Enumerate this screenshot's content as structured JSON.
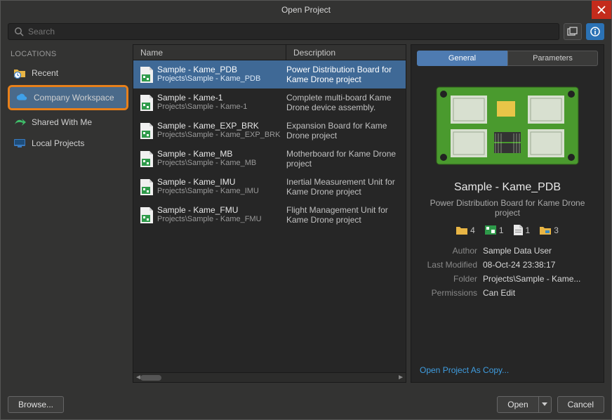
{
  "window": {
    "title": "Open Project"
  },
  "search": {
    "placeholder": "Search",
    "value": ""
  },
  "locations": {
    "label": "LOCATIONS",
    "items": [
      {
        "icon": "clock-folder",
        "label": "Recent"
      },
      {
        "icon": "cloud",
        "label": "Company Workspace"
      },
      {
        "icon": "share-arrow",
        "label": "Shared With Me"
      },
      {
        "icon": "monitor",
        "label": "Local Projects"
      }
    ],
    "selected_index": 1
  },
  "list": {
    "columns": {
      "name": "Name",
      "description": "Description"
    },
    "rows": [
      {
        "name": "Sample - Kame_PDB",
        "path": "Projects\\Sample - Kame_PDB",
        "desc": "Power Distribution Board for Kame Drone project"
      },
      {
        "name": "Sample - Kame-1",
        "path": "Projects\\Sample - Kame-1",
        "desc": "Complete multi-board Kame Drone device assembly."
      },
      {
        "name": "Sample - Kame_EXP_BRK",
        "path": "Projects\\Sample - Kame_EXP_BRK",
        "desc": "Expansion Board for Kame Drone project"
      },
      {
        "name": "Sample - Kame_MB",
        "path": "Projects\\Sample - Kame_MB",
        "desc": "Motherboard for Kame Drone project"
      },
      {
        "name": "Sample - Kame_IMU",
        "path": "Projects\\Sample - Kame_IMU",
        "desc": "Inertial Measurement Unit for Kame Drone project"
      },
      {
        "name": "Sample - Kame_FMU",
        "path": "Projects\\Sample - Kame_FMU",
        "desc": "Flight Management Unit for Kame Drone project"
      }
    ],
    "selected_index": 0
  },
  "detail": {
    "tabs": [
      "General",
      "Parameters"
    ],
    "active_tab": 0,
    "title": "Sample - Kame_PDB",
    "subtitle": "Power Distribution Board for Kame Drone project",
    "stats": [
      {
        "icon": "folder",
        "value": "4"
      },
      {
        "icon": "pcb",
        "value": "1"
      },
      {
        "icon": "doc",
        "value": "1"
      },
      {
        "icon": "layers",
        "value": "3"
      }
    ],
    "meta": {
      "Author": "Sample Data User",
      "Last Modified": "08-Oct-24 23:38:17",
      "Folder": "Projects\\Sample - Kame...",
      "Permissions": "Can Edit"
    },
    "open_as_copy": "Open Project As Copy..."
  },
  "footer": {
    "browse": "Browse...",
    "open": "Open",
    "cancel": "Cancel"
  }
}
